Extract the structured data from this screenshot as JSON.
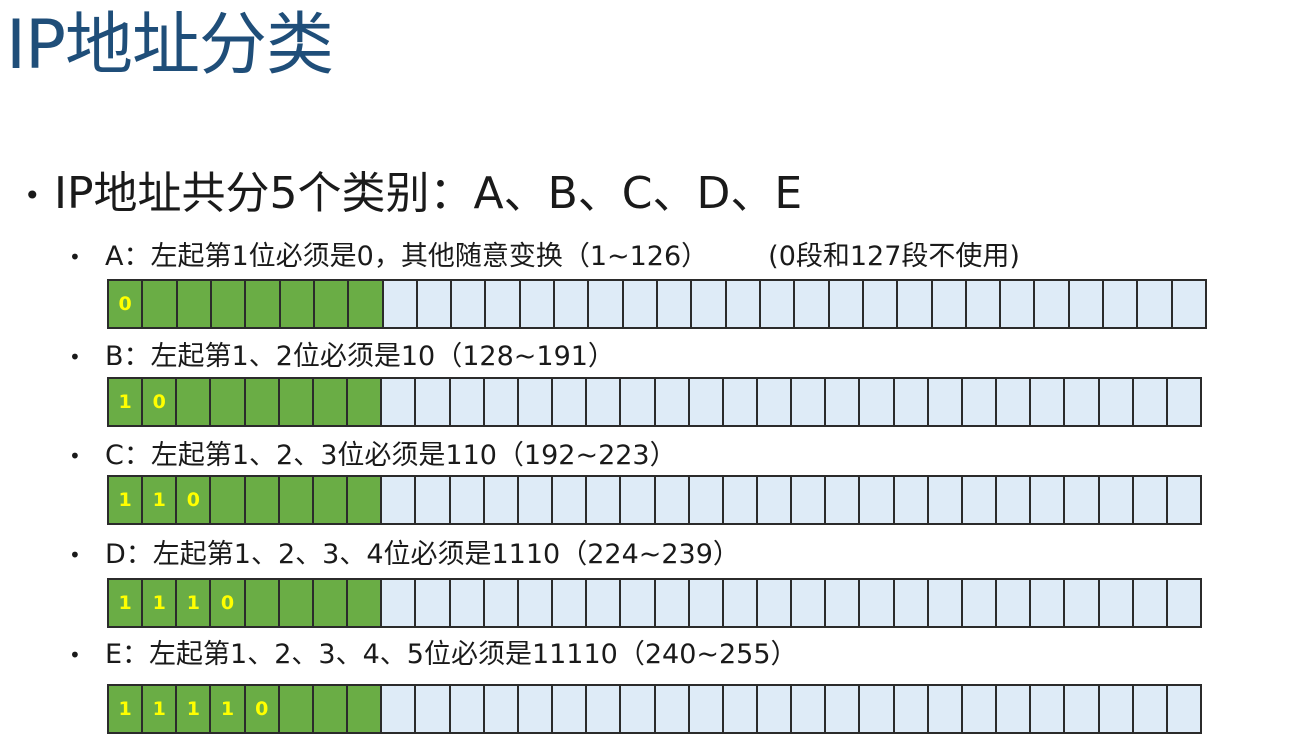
{
  "title": "IP地址分类",
  "main_bullet": "IP地址共分5个类别：A、B、C、D、E",
  "colors": {
    "title": "#1f4e79",
    "network_bits": "#6aad45",
    "host_bits": "#deebf7",
    "fixed_bit_text": "#ffff00"
  },
  "classes": [
    {
      "label": "A：左起第1位必须是0，其他随意变换（1~126）",
      "note": "(0段和127段不使用)",
      "fixed_bits": [
        "0"
      ],
      "network_bit_count": 8,
      "total_bits": 32
    },
    {
      "label": "B：左起第1、2位必须是10（128~191）",
      "fixed_bits": [
        "1",
        "0"
      ],
      "network_bit_count": 8,
      "total_bits": 32
    },
    {
      "label": "C：左起第1、2、3位必须是110（192~223）",
      "fixed_bits": [
        "1",
        "1",
        "0"
      ],
      "network_bit_count": 8,
      "total_bits": 32
    },
    {
      "label": "D：左起第1、2、3、4位必须是1110（224~239）",
      "fixed_bits": [
        "1",
        "1",
        "1",
        "0"
      ],
      "network_bit_count": 8,
      "total_bits": 32
    },
    {
      "label": "E：左起第1、2、3、4、5位必须是11110（240~255）",
      "fixed_bits": [
        "1",
        "1",
        "1",
        "1",
        "0"
      ],
      "network_bit_count": 8,
      "total_bits": 32
    }
  ]
}
